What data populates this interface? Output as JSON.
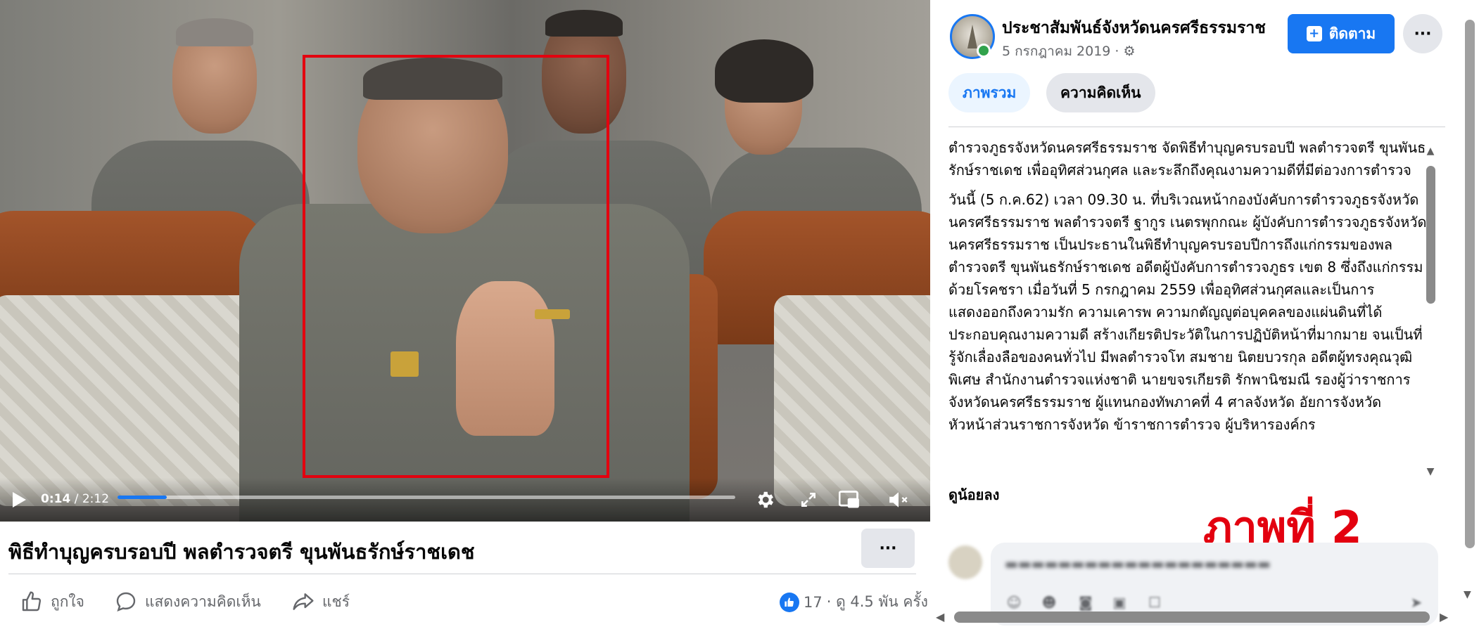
{
  "video": {
    "current_time": "0:14",
    "duration": " / 2:12",
    "progress": 0.08
  },
  "video_meta": {
    "title": "พิธีทำบุญครบรอบปี พลตำรวจตรี ขุนพันธรักษ์ราชเดช",
    "more_label": "···",
    "like_label": "ถูกใจ",
    "comment_label": "แสดงความคิดเห็น",
    "share_label": "แชร์",
    "reaction_count": "17",
    "views": "· ดู 4.5 พัน ครั้ง"
  },
  "post": {
    "page_name": "ประชาสัมพันธ์จังหวัดนครศรีธรรมราช",
    "date": "5 กรกฎาคม 2019 · ⚙",
    "follow_label": "ติดตาม",
    "more_label": "···",
    "tabs": [
      {
        "label": "ภาพรวม",
        "active": true
      },
      {
        "label": "ความคิดเห็น",
        "active": false
      }
    ],
    "paragraph1": "ตำรวจภูธรจังหวัดนครศรีธรรมราช จัดพิธีทำบุญครบรอบปี พลตำรวจตรี ขุนพันธรักษ์ราชเดช เพื่ออุทิศส่วนกุศล และระลึกถึงคุณงามความดีที่มีต่อวงการตำรวจ",
    "paragraph2": "วันนี้ (5 ก.ค.62) เวลา 09.30 น. ที่บริเวณหน้ากองบังคับการตำรวจภูธรจังหวัดนครศรีธรรมราช พลตำรวจตรี ฐากูร เนตรพุกกณะ ผู้บังคับการตำรวจภูธรจังหวัดนครศรีธรรมราช เป็นประธานในพิธีทำบุญครบรอบปีการถึงแก่กรรมของพลตำรวจตรี ขุนพันธรักษ์ราชเดช อดีตผู้บังคับการตำรวจภูธร เขต 8 ซึ่งถึงแก่กรรมด้วยโรคชรา เมื่อวันที่ 5 กรกฎาคม 2559 เพื่ออุทิศส่วนกุศลและเป็นการแสดงออกถึงความรัก ความเคารพ ความกตัญญูต่อบุคคลของแผ่นดินที่ได้ประกอบคุณงามความดี สร้างเกียรติประวัติในการปฏิบัติหน้าที่มากมาย จนเป็นที่รู้จักเลื่องลือของคนทั่วไป มีพลตำรวจโท สมชาย นิตยบวรกุล อดีตผู้ทรงคุณวุฒิพิเศษ สำนักงานตำรวจแห่งชาติ นายขจรเกียรติ รักพานิชมณี รองผู้ว่าราชการจังหวัดนครศรีธรรมราช ผู้แทนกองทัพภาคที่ 4 ศาลจังหวัด อัยการจังหวัด หัวหน้าส่วนราชการจังหวัด ข้าราชการตำรวจ ผู้บริหารองค์กร",
    "see_less": "ดูน้อยลง"
  },
  "overlay_label": "ภาพที่ 2",
  "colors": {
    "accent": "#1877f2",
    "highlight_red": "#e3000f",
    "online_green": "#31a24c"
  }
}
